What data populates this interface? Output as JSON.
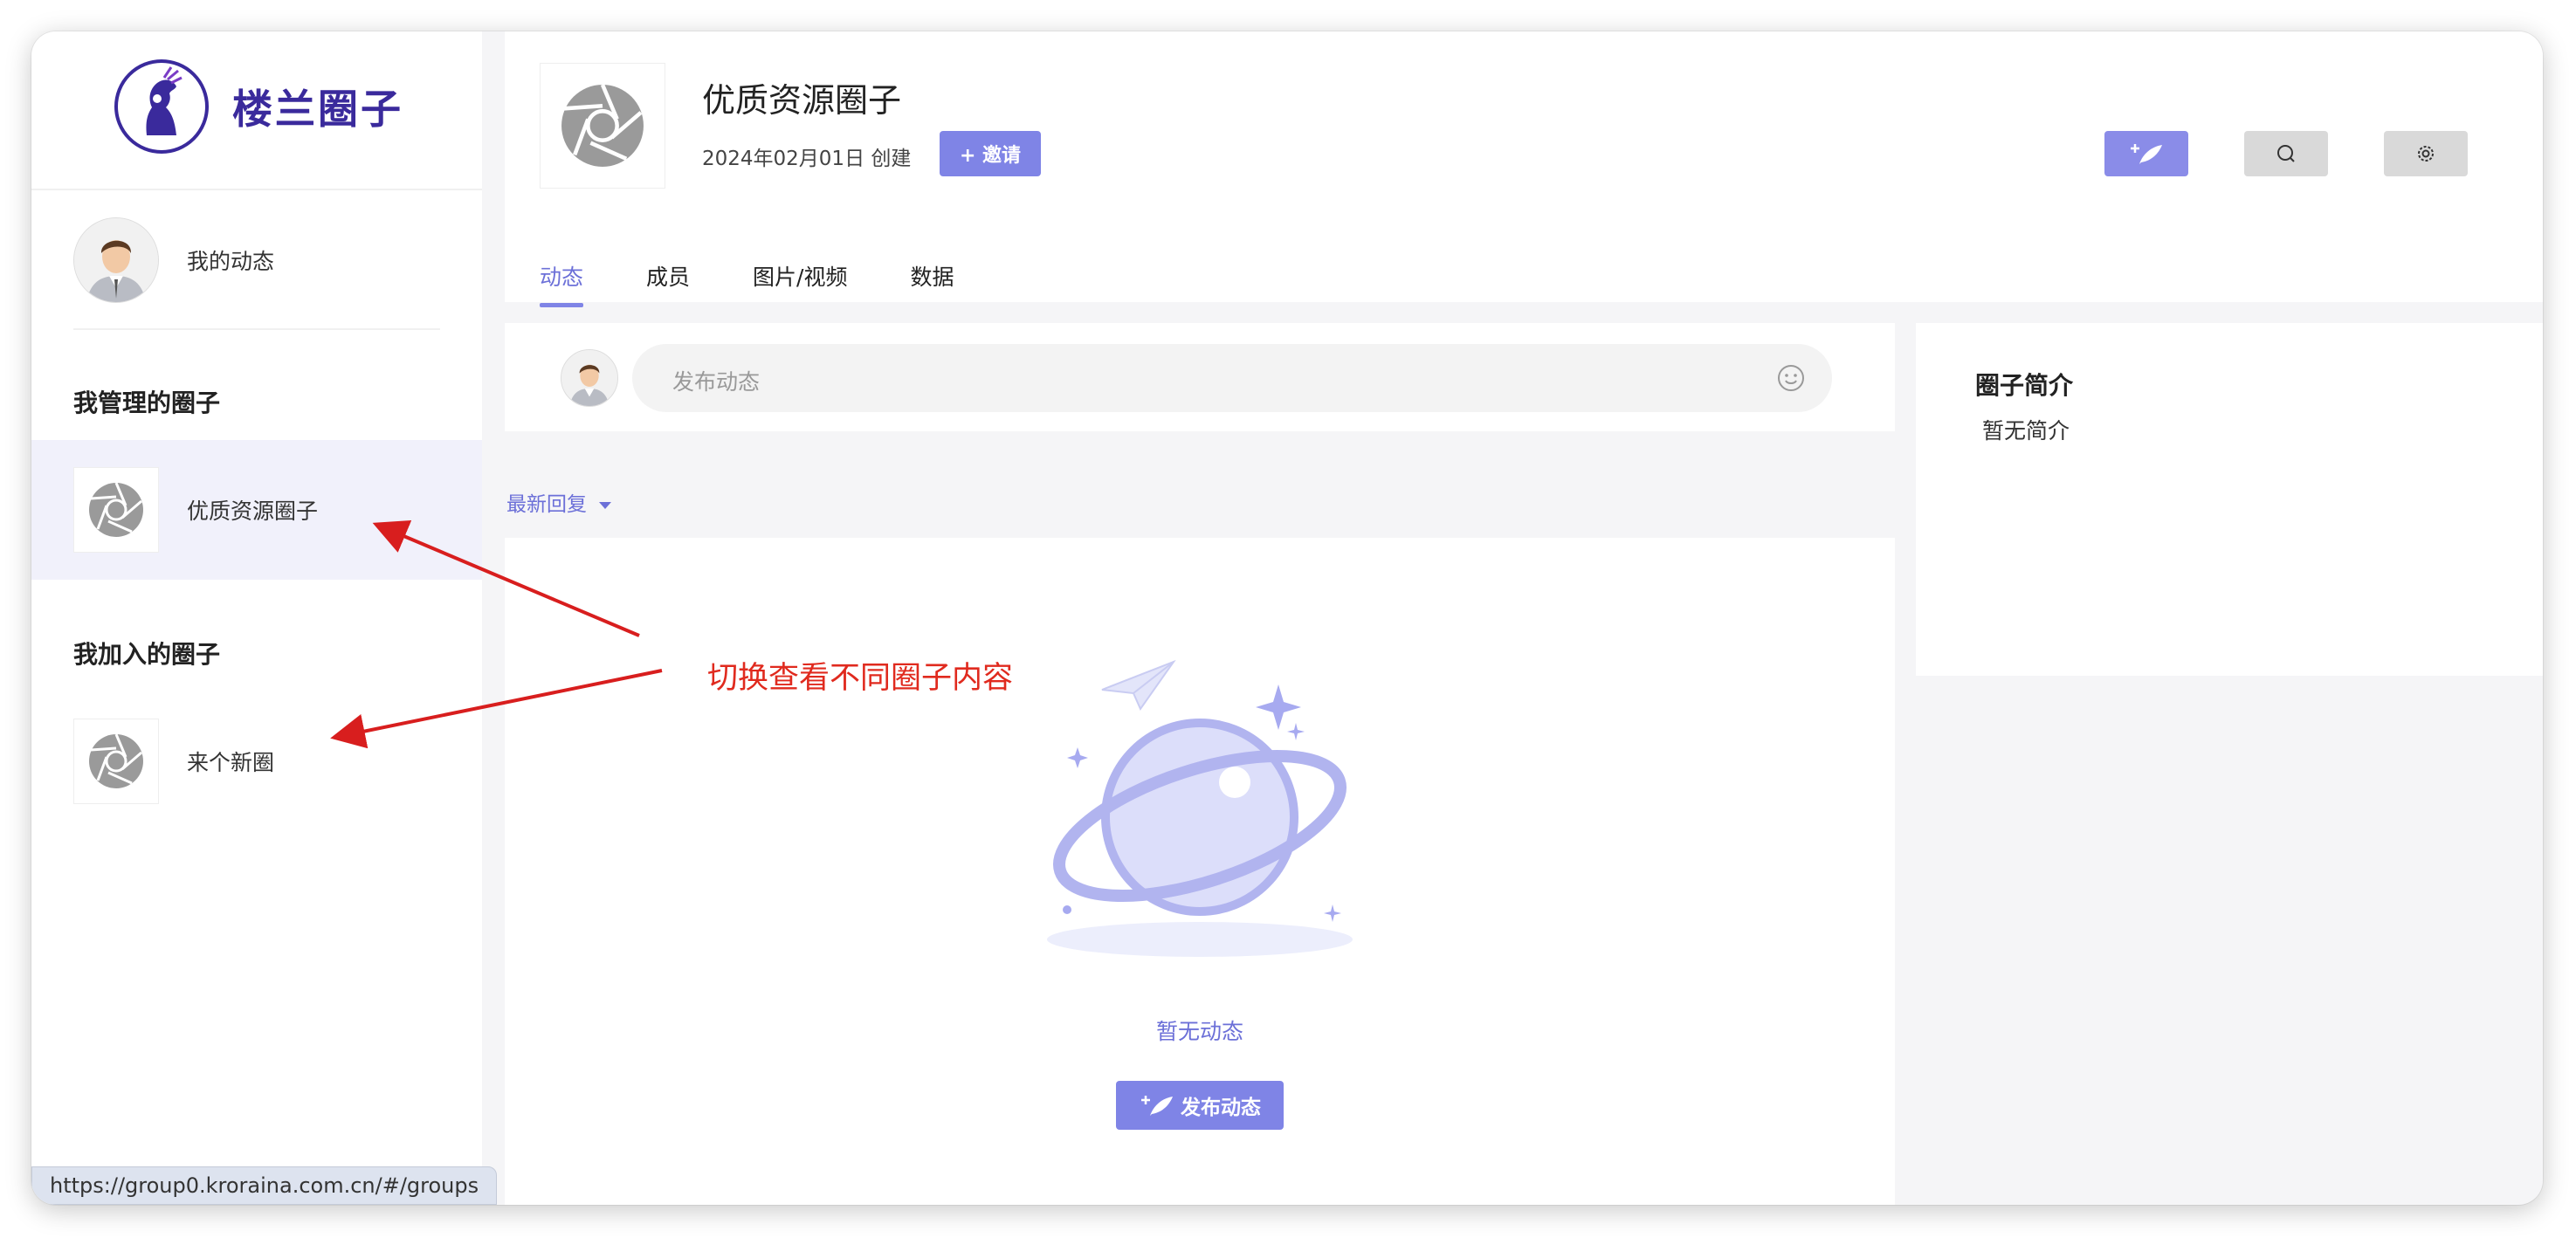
{
  "brand": {
    "name": "楼兰圈子"
  },
  "sidebar": {
    "my_activity_label": "我的动态",
    "managed_title": "我管理的圈子",
    "managed_groups": [
      {
        "label": "优质资源圈子",
        "active": true
      }
    ],
    "joined_title": "我加入的圈子",
    "joined_groups": [
      {
        "label": "来个新圈",
        "active": false
      }
    ]
  },
  "status_bar": {
    "url": "https://group0.kroraina.com.cn/#/groups"
  },
  "group": {
    "title": "优质资源圈子",
    "created": "2024年02月01日 创建",
    "invite_label": "+ 邀请"
  },
  "header_buttons": [
    {
      "icon": "post-feather-icon"
    },
    {
      "icon": "search-icon"
    },
    {
      "icon": "gear-icon"
    }
  ],
  "tabs": [
    {
      "label": "动态",
      "active": true
    },
    {
      "label": "成员",
      "active": false
    },
    {
      "label": "图片/视频",
      "active": false
    },
    {
      "label": "数据",
      "active": false
    }
  ],
  "composer": {
    "placeholder": "发布动态"
  },
  "sort": {
    "label": "最新回复"
  },
  "feed": {
    "empty_text": "暂无动态",
    "post_button_label": "发布动态"
  },
  "intro": {
    "title": "圈子简介",
    "body": "暂无简介"
  },
  "annotation": {
    "text": "切换查看不同圈子内容",
    "color": "#e02a1e"
  },
  "colors": {
    "accent": "#7f84e6",
    "brand": "#3a2a9c"
  }
}
